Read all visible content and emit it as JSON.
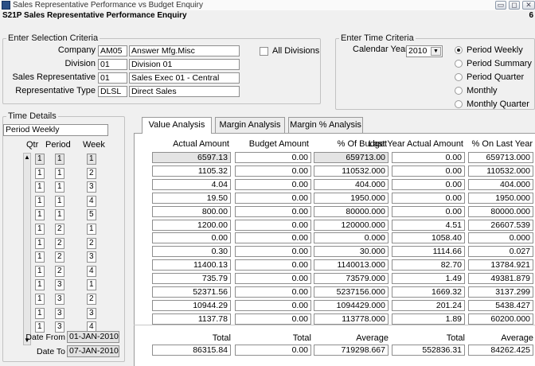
{
  "window": {
    "title": "Sales Representative Performance vs Budget Enquiry",
    "subheader": "S21P Sales Representative Performance Enquiry",
    "subheader_right": "6"
  },
  "selection": {
    "legend": "Enter Selection Criteria",
    "company_label": "Company",
    "company_code": "AM05",
    "company_name": "Answer Mfg.Misc",
    "division_label": "Division",
    "division_code": "01",
    "division_name": "Division 01",
    "rep_label": "Sales Representative",
    "rep_code": "01",
    "rep_name": "Sales Exec 01 - Central",
    "reptype_label": "Representative Type",
    "reptype_code": "DLSL",
    "reptype_name": "Direct Sales",
    "all_divisions_label": "All Divisions"
  },
  "time_criteria": {
    "legend": "Enter Time Criteria",
    "year_label": "Calendar Year",
    "year_value": "2010",
    "options": [
      "Period Weekly",
      "Period Summary",
      "Period Quarter",
      "Monthly",
      "Monthly Quarter"
    ],
    "selected": 0
  },
  "time_details": {
    "legend": "Time Details",
    "mode": "Period Weekly",
    "headers": [
      "Qtr",
      "Period",
      "Week"
    ],
    "rows": [
      [
        "1",
        "1",
        "1"
      ],
      [
        "1",
        "1",
        "2"
      ],
      [
        "1",
        "1",
        "3"
      ],
      [
        "1",
        "1",
        "4"
      ],
      [
        "1",
        "1",
        "5"
      ],
      [
        "1",
        "2",
        "1"
      ],
      [
        "1",
        "2",
        "2"
      ],
      [
        "1",
        "2",
        "3"
      ],
      [
        "1",
        "2",
        "4"
      ],
      [
        "1",
        "3",
        "1"
      ],
      [
        "1",
        "3",
        "2"
      ],
      [
        "1",
        "3",
        "3"
      ],
      [
        "1",
        "3",
        "4"
      ]
    ],
    "date_from_label": "Date From",
    "date_from": "01-JAN-2010",
    "date_to_label": "Date To",
    "date_to": "07-JAN-2010"
  },
  "tabs": [
    "Value Analysis",
    "Margin Analysis",
    "Margin % Analysis"
  ],
  "table": {
    "headers": [
      "Actual Amount",
      "Budget Amount",
      "% Of Budget",
      "Last Year Actual Amount",
      "% On Last Year"
    ],
    "rows": [
      [
        "6597.13",
        "0.00",
        "659713.00",
        "0.00",
        "659713.000"
      ],
      [
        "1105.32",
        "0.00",
        "110532.000",
        "0.00",
        "110532.000"
      ],
      [
        "4.04",
        "0.00",
        "404.000",
        "0.00",
        "404.000"
      ],
      [
        "19.50",
        "0.00",
        "1950.000",
        "0.00",
        "1950.000"
      ],
      [
        "800.00",
        "0.00",
        "80000.000",
        "0.00",
        "80000.000"
      ],
      [
        "1200.00",
        "0.00",
        "120000.000",
        "4.51",
        "26607.539"
      ],
      [
        "0.00",
        "0.00",
        "0.000",
        "1058.40",
        "0.000"
      ],
      [
        "0.30",
        "0.00",
        "30.000",
        "1114.66",
        "0.027"
      ],
      [
        "11400.13",
        "0.00",
        "1140013.000",
        "82.70",
        "13784.921"
      ],
      [
        "735.79",
        "0.00",
        "73579.000",
        "1.49",
        "49381.879"
      ],
      [
        "52371.56",
        "0.00",
        "5237156.000",
        "1669.32",
        "3137.299"
      ],
      [
        "10944.29",
        "0.00",
        "1094429.000",
        "201.24",
        "5438.427"
      ],
      [
        "1137.78",
        "0.00",
        "113778.000",
        "1.89",
        "60200.000"
      ]
    ],
    "footer_labels": [
      "Total",
      "Total",
      "Average",
      "Total",
      "Average"
    ],
    "footer_values": [
      "86315.84",
      "0.00",
      "719298.667",
      "552836.31",
      "84262.425"
    ]
  }
}
